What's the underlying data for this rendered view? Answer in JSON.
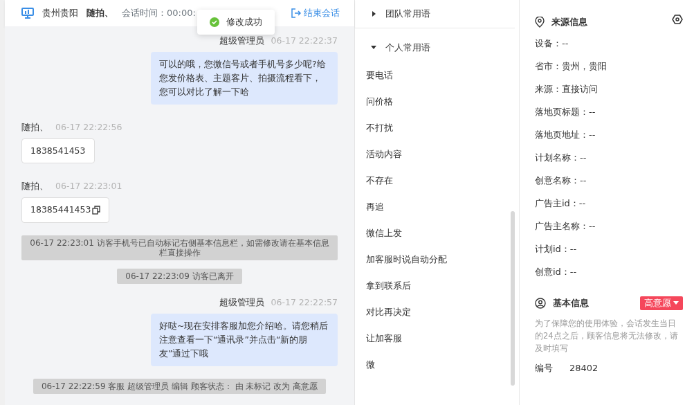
{
  "header": {
    "location": "贵州贵阳",
    "visitor": "随拍、",
    "session_time": "会话时间：00:00:",
    "end_button": "结束会话"
  },
  "toast": {
    "text": "修改成功"
  },
  "messages": [
    {
      "kind": "agent",
      "sender": "超级管理员",
      "time": "06-17 22:22:37",
      "text": "可以的哦，您微信号或者手机号多少呢?给您发价格表、主题客片、拍摄流程看下，您可以对比了解一下哈"
    },
    {
      "kind": "visitor",
      "sender": "随拍、",
      "time": "06-17 22:22:56",
      "text": "1838541453",
      "copyable": false
    },
    {
      "kind": "visitor",
      "sender": "随拍、",
      "time": "06-17 22:23:01",
      "text": "18385441453",
      "copyable": true
    },
    {
      "kind": "system",
      "text": "06-17 22:23:01 访客手机号已自动标记右侧基本信息栏，如需修改请在基本信息栏直接操作"
    },
    {
      "kind": "system",
      "text": "06-17 22:23:09 访客已离开"
    },
    {
      "kind": "agent",
      "sender": "超级管理员",
      "time": "06-17 22:22:57",
      "text": "好哒~现在安排客服加您介绍哈。请您稍后注意查看一下“通讯录”并点击“新的朋友”通过下哦"
    },
    {
      "kind": "system",
      "text": "06-17 22:22:59 客服 超级管理员 编辑 顾客状态： 由 未标记 改为 高意愿"
    }
  ],
  "phrase_groups": [
    {
      "title": "团队常用语",
      "expanded": false
    },
    {
      "title": "个人常用语",
      "expanded": true,
      "items": [
        "要电话",
        "问价格",
        "不打扰",
        "活动内容",
        "不存在",
        "再追",
        "微信上发",
        "加客服时说自动分配",
        "拿到联系后",
        "对比再决定",
        "让加客服",
        "微"
      ]
    }
  ],
  "source_info": {
    "title": "来源信息",
    "fields": [
      "设备：--",
      "省市：贵州，贵阳",
      "来源：直接访问",
      "落地页标题：--",
      "落地页地址：--",
      "计划名称：--",
      "创意名称：--",
      "广告主id：--",
      "广告主名称：--",
      "计划id：--",
      "创意id：--"
    ]
  },
  "basic_info": {
    "title": "基本信息",
    "status": "高意愿",
    "notice": "为了保障您的使用体验，会话发生当日的24点之后，顾客信息将无法修改，请及时填写",
    "number_label": "编号",
    "number_value": "28402"
  }
}
